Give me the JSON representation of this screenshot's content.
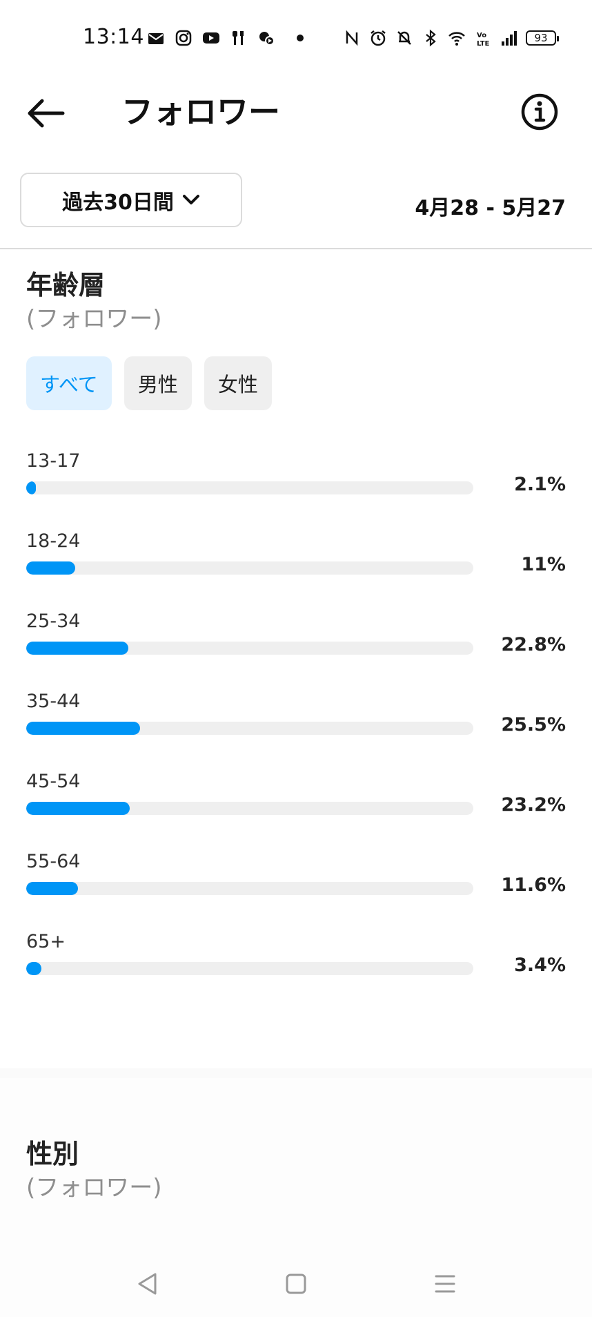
{
  "status_bar": {
    "time": "13:14",
    "battery": "93",
    "icons": [
      "mail-icon",
      "instagram-icon",
      "youtube-icon",
      "restaurant-icon",
      "app-icon",
      "nfc-icon",
      "alarm-icon",
      "mute-icon",
      "bluetooth-icon",
      "wifi-icon",
      "volte-icon",
      "signal-icon"
    ]
  },
  "header": {
    "title": "フォロワー"
  },
  "range": {
    "label": "過去30日間",
    "dates": "4月28 - 5月27"
  },
  "age_section": {
    "title": "年齢層",
    "subtitle": "(フォロワー)",
    "filters": [
      "すべて",
      "男性",
      "女性"
    ],
    "active_filter": "すべて"
  },
  "chart_data": {
    "type": "bar",
    "orientation": "horizontal",
    "categories": [
      "13-17",
      "18-24",
      "25-34",
      "35-44",
      "45-54",
      "55-64",
      "65+"
    ],
    "values": [
      2.1,
      11,
      22.8,
      25.5,
      23.2,
      11.6,
      3.4
    ],
    "value_labels": [
      "2.1%",
      "11%",
      "22.8%",
      "25.5%",
      "23.2%",
      "11.6%",
      "3.4%"
    ],
    "bar_color": "#0095f6",
    "track_color": "#efefef"
  },
  "gender_section": {
    "title": "性別",
    "subtitle": "(フォロワー)"
  },
  "colors": {
    "accent": "#0095f6",
    "chip_active_bg": "#e0f1ff",
    "chip_bg": "#efefef"
  }
}
